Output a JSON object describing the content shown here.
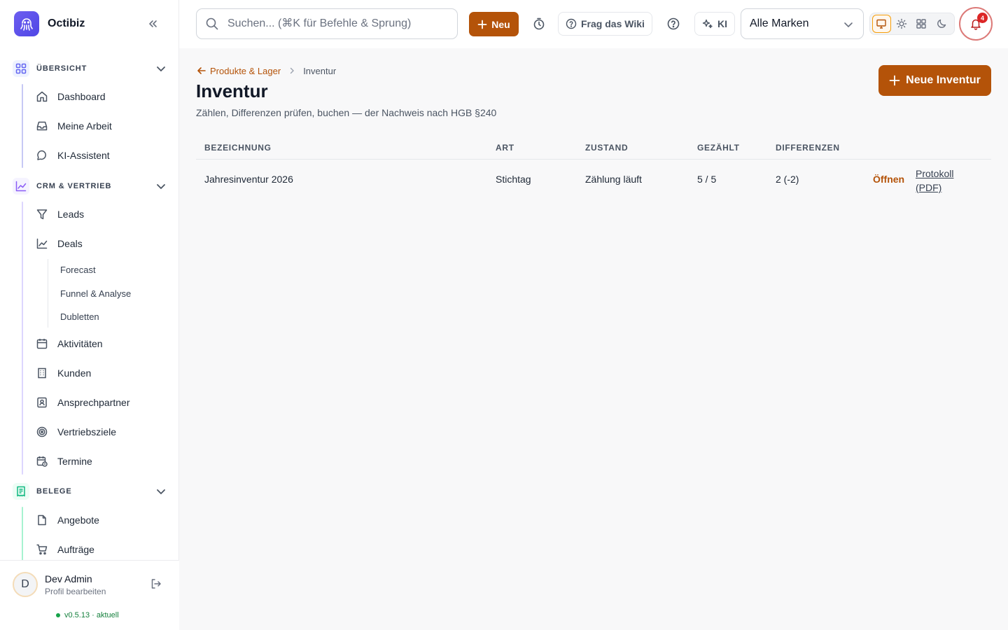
{
  "app": {
    "name": "Octibiz"
  },
  "sidebar": {
    "sections": [
      {
        "label": "ÜBERSICHT",
        "color": "#6366f1",
        "items": [
          "Dashboard",
          "Meine Arbeit",
          "KI-Assistent"
        ]
      },
      {
        "label": "CRM & VERTRIEB",
        "color": "#8b5cf6",
        "items": [
          "Leads",
          "Deals",
          "Aktivitäten",
          "Kunden",
          "Ansprechpartner",
          "Vertriebsziele",
          "Termine"
        ],
        "sub_items": [
          "Forecast",
          "Funnel & Analyse",
          "Dubletten"
        ]
      },
      {
        "label": "BELEGE",
        "color": "#10b981",
        "items": [
          "Angebote",
          "Aufträge"
        ]
      }
    ]
  },
  "user": {
    "initial": "D",
    "name": "Dev Admin",
    "sub": "Profil bearbeiten"
  },
  "version": {
    "label": "v0.5.13 · aktuell"
  },
  "topbar": {
    "search_placeholder": "Suchen... (⌘K für Befehle & Sprung)",
    "new_label": "Neu",
    "wiki_label": "Frag das Wiki",
    "ai_label": "KI",
    "brand_select": "Alle Marken",
    "notifications": "4"
  },
  "page": {
    "breadcrumb_parent": "Produkte & Lager",
    "breadcrumb_current": "Inventur",
    "title": "Inventur",
    "subtitle": "Zählen, Differenzen prüfen, buchen — der Nachweis nach HGB §240",
    "new_button": "Neue Inventur"
  },
  "table": {
    "columns": [
      "BEZEICHNUNG",
      "ART",
      "ZUSTAND",
      "GEZÄHLT",
      "DIFFERENZEN"
    ],
    "rows": [
      {
        "name": "Jahresinventur 2026",
        "type": "Stichtag",
        "state": "Zählung läuft",
        "counted": "5 / 5",
        "diff": "2 (-2)",
        "open": "Öffnen",
        "pdf": "Protokoll (PDF)"
      }
    ]
  },
  "colors": {
    "accent": "#b45309",
    "brand": "#5b4ce8"
  }
}
